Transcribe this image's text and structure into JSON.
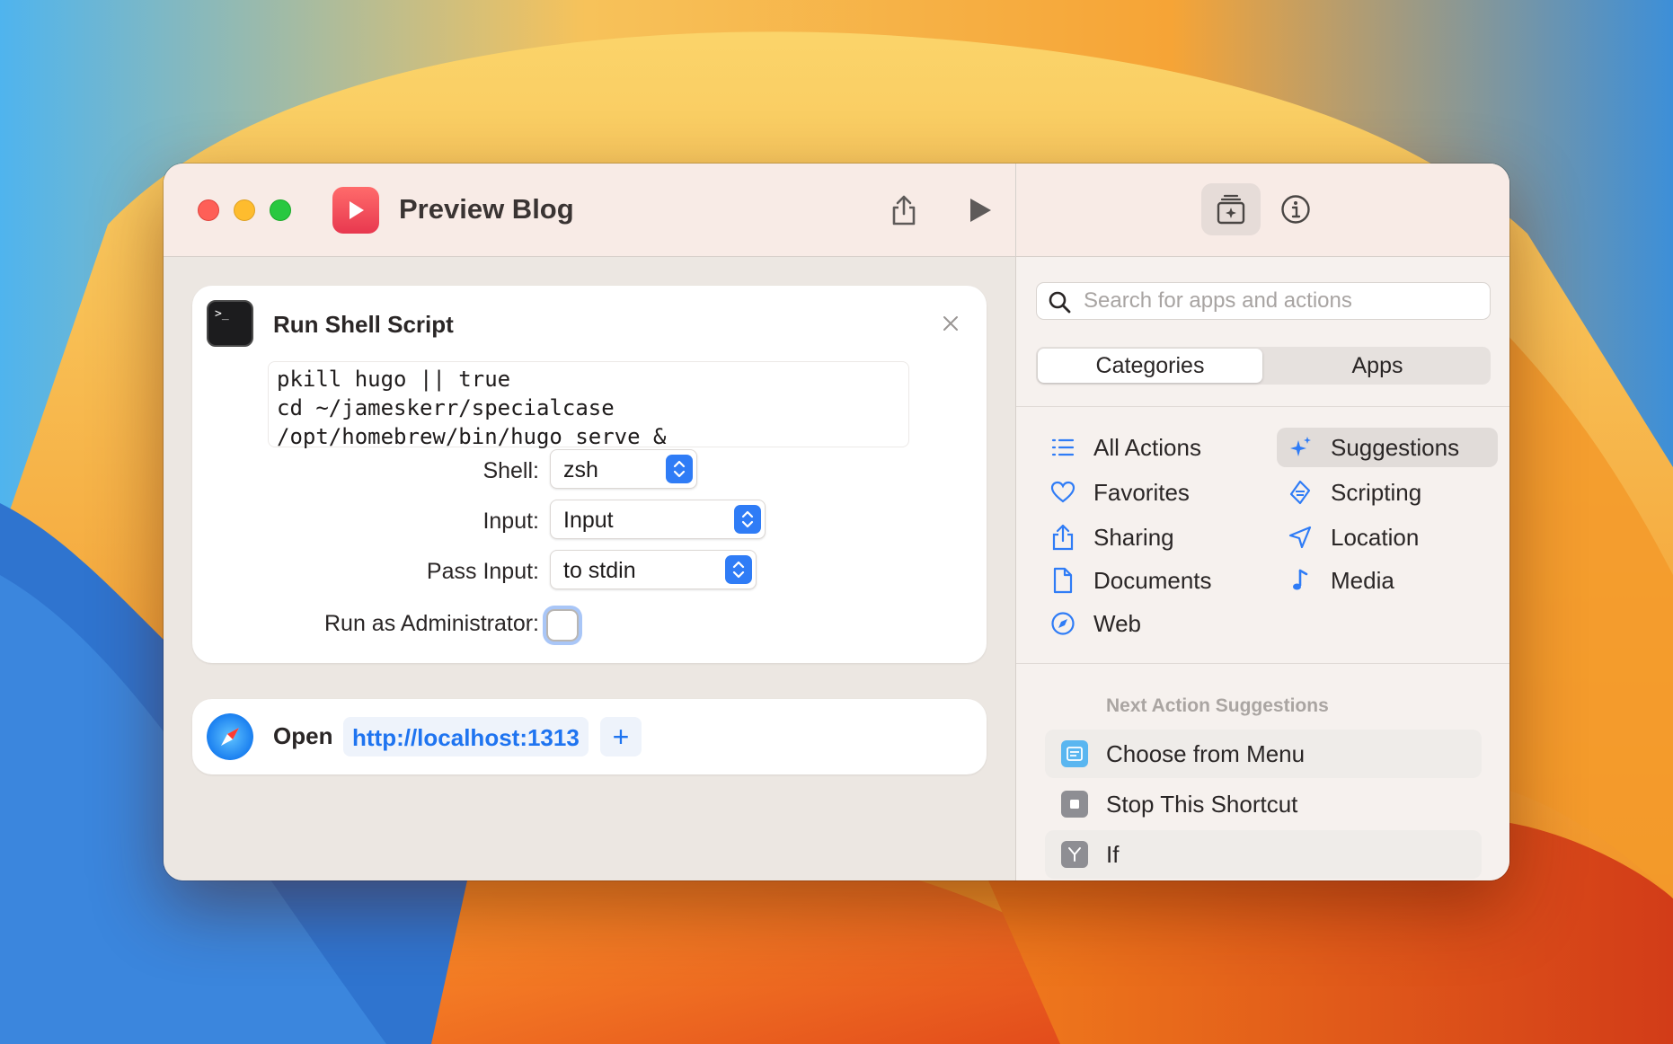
{
  "window": {
    "title": "Preview Blog"
  },
  "colors": {
    "accent": "#2f7cf6",
    "link": "#1f74f0",
    "app_icon": "#e8384f"
  },
  "actions": {
    "shell": {
      "title": "Run Shell Script",
      "script": "pkill hugo || true\ncd ~/jameskerr/specialcase\n/opt/homebrew/bin/hugo serve &",
      "params": {
        "shell": {
          "label": "Shell:",
          "value": "zsh"
        },
        "input": {
          "label": "Input:",
          "value": "Input"
        },
        "pass_input": {
          "label": "Pass Input:",
          "value": "to stdin"
        },
        "run_as_admin": {
          "label": "Run as Administrator:",
          "checked": false
        }
      }
    },
    "open": {
      "label": "Open",
      "url": "http://localhost:1313",
      "plus": "+"
    }
  },
  "sidebar": {
    "search": {
      "placeholder": "Search for apps and actions",
      "value": ""
    },
    "tabs": [
      {
        "label": "Categories",
        "active": true
      },
      {
        "label": "Apps",
        "active": false
      }
    ],
    "categories_left": [
      {
        "label": "All Actions",
        "icon": "list-icon"
      },
      {
        "label": "Favorites",
        "icon": "heart-icon"
      },
      {
        "label": "Sharing",
        "icon": "share-icon"
      },
      {
        "label": "Documents",
        "icon": "document-icon"
      },
      {
        "label": "Web",
        "icon": "compass-icon"
      }
    ],
    "categories_right": [
      {
        "label": "Suggestions",
        "icon": "sparkles-icon",
        "selected": true
      },
      {
        "label": "Scripting",
        "icon": "scripting-icon"
      },
      {
        "label": "Location",
        "icon": "location-arrow-icon"
      },
      {
        "label": "Media",
        "icon": "music-note-icon"
      }
    ],
    "next_header": "Next Action Suggestions",
    "suggestions": [
      {
        "label": "Choose from Menu",
        "icon": "menu-icon"
      },
      {
        "label": "Stop This Shortcut",
        "icon": "stop-icon"
      },
      {
        "label": "If",
        "icon": "branch-icon"
      }
    ]
  }
}
